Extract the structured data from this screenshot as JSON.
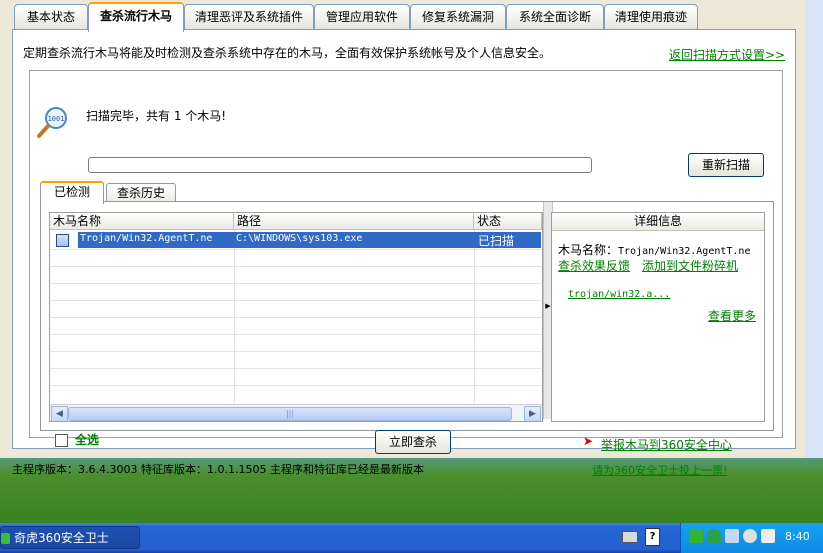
{
  "tabs": [
    {
      "label": "基本状态"
    },
    {
      "label": "查杀流行木马"
    },
    {
      "label": "清理恶评及系统插件"
    },
    {
      "label": "管理应用软件"
    },
    {
      "label": "修复系统漏洞"
    },
    {
      "label": "系统全面诊断"
    },
    {
      "label": "清理使用痕迹"
    }
  ],
  "header": {
    "description": "定期查杀流行木马将能及时检测及查杀系统中存在的木马，全面有效保护系统帐号及个人信息安全。",
    "back_link": "返回扫描方式设置>>"
  },
  "scan": {
    "status": "扫描完毕，共有 1 个木马!",
    "progress": 0,
    "rescan_label": "重新扫描"
  },
  "subtabs": [
    {
      "label": "已检测"
    },
    {
      "label": "查杀历史"
    }
  ],
  "table": {
    "columns": [
      "木马名称",
      "路径",
      "状态"
    ],
    "rows": [
      {
        "name": "Trojan/Win32.AgentT.ne",
        "path": "C:\\WINDOWS\\sys103.exe",
        "status": "已扫描"
      }
    ]
  },
  "detail": {
    "title": "详细信息",
    "name_label": "木马名称：",
    "name_value": "Trojan/Win32.AgentT.ne",
    "feedback_link": "查杀效果反馈",
    "shredder_link": "添加到文件粉碎机",
    "info_link": "trojan/win32.a...",
    "more_link": "查看更多"
  },
  "actions": {
    "select_all": "全选",
    "kill_now": "立即查杀",
    "report": "举报木马到360安全中心"
  },
  "footer": {
    "version": "主程序版本：3.6.4.3003 特征库版本：1.0.1.1505 主程序和特征库已经是最新版本",
    "vote_link": "请为360安全卫士投上一票!"
  },
  "taskbar": {
    "app_label": "奇虎360安全卫士",
    "clock": "8:40"
  },
  "colors": {
    "accent_tab": "#ff9f00",
    "link": "#008000",
    "selection": "#316ac5",
    "taskbar": "#245fd0"
  }
}
